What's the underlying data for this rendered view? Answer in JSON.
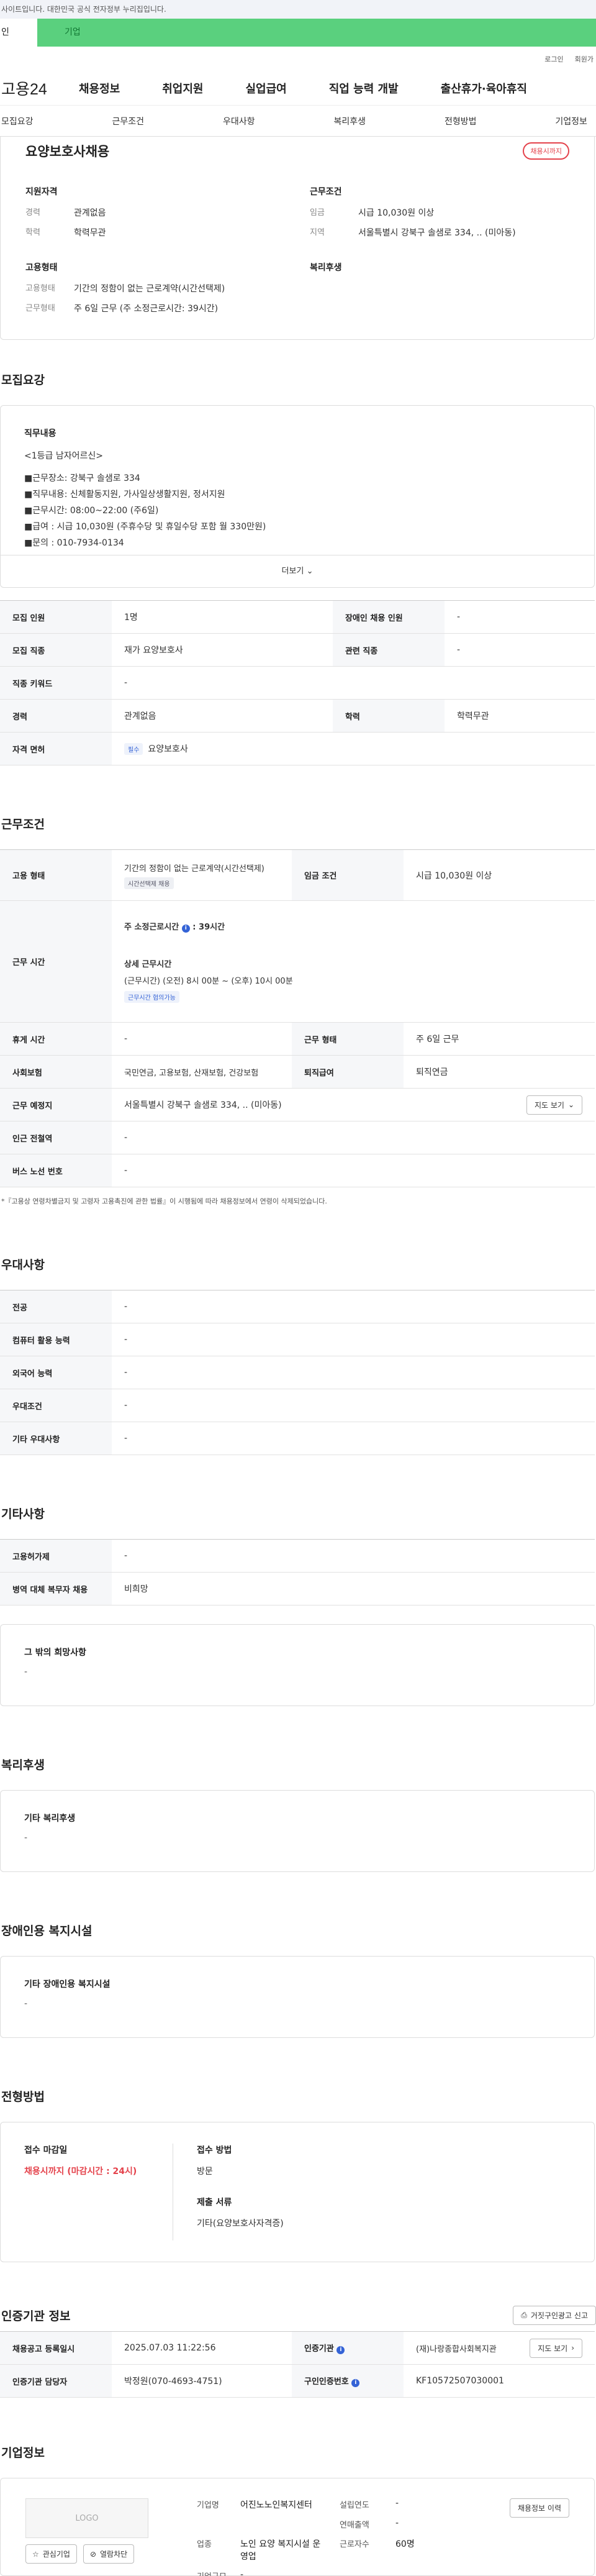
{
  "topbar": {
    "notice": "사이트입니다. 대한민국 공식 전자정부 누리집입니다."
  },
  "user_tabs": {
    "individual": "인",
    "company": "기업"
  },
  "login_links": [
    "로그인",
    "회원가"
  ],
  "gnb": {
    "logo": "고용24",
    "items": [
      "채용정보",
      "취업지원",
      "실업급여",
      "직업 능력 개발",
      "출산휴가·육아휴직"
    ]
  },
  "subnav": [
    "모집요강",
    "근무조건",
    "우대사항",
    "복리후생",
    "전형방법",
    "기업정보"
  ],
  "summary": {
    "title": "요양보호사채용",
    "badge": "채용시까지",
    "qualification": {
      "heading": "지원자격",
      "rows": [
        {
          "k": "경력",
          "v": "관계없음"
        },
        {
          "k": "학력",
          "v": "학력무관"
        }
      ]
    },
    "employment": {
      "heading": "고용형태",
      "rows": [
        {
          "k": "고용형태",
          "v": "기간의 정함이 없는 근로계약(시간선택제)"
        },
        {
          "k": "근무형태",
          "v": "주 6일 근무 (주 소정근로시간: 39시간)"
        }
      ]
    },
    "conditions": {
      "heading": "근무조건",
      "rows": [
        {
          "k": "임금",
          "v": "시급 10,030원 이상"
        },
        {
          "k": "지역",
          "v": "서울특별시 강북구 솔샘로 334, .. (미아동)"
        }
      ]
    },
    "welfare": {
      "heading": "복리후생"
    }
  },
  "recruit": {
    "title": "모집요강",
    "duty_heading": "직무내용",
    "duty_lines": [
      "<1등급 남자어르신>",
      "■근무장소: 강북구 솔샘로 334",
      "■직무내용: 신체활동지원, 가사일상생활지원, 정서지원",
      "■근무시간: 08:00~22:00 (주6일)",
      "■급여 : 시급 10,030원 (주휴수당 및 휴일수당 포함 월 330만원)",
      "■문의 : 010-7934-0134"
    ],
    "more": "더보기",
    "table": [
      [
        "모집 인원",
        "1명",
        "장애인 채용 인원",
        "-"
      ],
      [
        "모집 직종",
        "재가 요양보호사",
        "관련 직종",
        "-"
      ],
      [
        "직종 키워드",
        "-",
        "",
        ""
      ],
      [
        "경력",
        "관계없음",
        "학력",
        "학력무관"
      ]
    ],
    "license_label": "자격 면허",
    "license_tag": "필수",
    "license_value": "요양보호사"
  },
  "work": {
    "title": "근무조건",
    "employ_type_label": "고용 형태",
    "employ_type_value": "기간의 정함이 없는 근로계약(시간선택제)",
    "employ_type_tag": "시간선택제 채용",
    "wage_label": "임금 조건",
    "wage_value": "시급 10,030원 이상",
    "hours_label": "근무 시간",
    "hours_weekly": "주 소정근로시간",
    "hours_weekly_value": "39시간",
    "hours_detail_heading": "상세 근무시간",
    "hours_detail": "(근무시간) (오전) 8시 00분 ~ (오후) 10시 00분",
    "hours_tag": "근무시간 협의가능",
    "rest_label": "휴게 시간",
    "rest_value": "-",
    "form_label": "근무 형태",
    "form_value": "주 6일 근무",
    "insurance_label": "사회보험",
    "insurance_value": "국민연금, 고용보험, 산재보험, 건강보험",
    "retire_label": "퇴직급여",
    "retire_value": "퇴직연금",
    "place_label": "근무 예정지",
    "place_value": "서울특별시 강북구 솔샘로 334, .. (미아동)",
    "map_btn": "지도 보기",
    "subway_label": "인근 전철역",
    "subway_value": "-",
    "bus_label": "버스 노선 번호",
    "bus_value": "-",
    "note": "*『고용상 연령차별금지 및 고령자 고용촉진에 관한 법률』이 시행됨에 따라 채용정보에서 연령이 삭제되었습니다."
  },
  "prefer": {
    "title": "우대사항",
    "rows": [
      [
        "전공",
        "-"
      ],
      [
        "컴퓨터 활용 능력",
        "-"
      ],
      [
        "외국어 능력",
        "-"
      ],
      [
        "우대조건",
        "-"
      ],
      [
        "기타 우대사항",
        "-"
      ]
    ]
  },
  "etc": {
    "title": "기타사항",
    "rows": [
      [
        "고용허가제",
        "-"
      ],
      [
        "병역 대체 복무자 채용",
        "비희망"
      ]
    ],
    "wish_heading": "그 밖의 희망사항",
    "wish_value": "-"
  },
  "welfare_sec": {
    "title": "복리후생",
    "heading": "기타 복리후생",
    "value": "-"
  },
  "disabled_sec": {
    "title": "장애인용 복지시설",
    "heading": "기타 장애인용 복지시설",
    "value": "-"
  },
  "method": {
    "title": "전형방법",
    "deadline_heading": "접수 마감일",
    "deadline_value": "채용시까지 (마감시간 : 24시)",
    "way_heading": "접수 방법",
    "way_value": "방문",
    "docs_heading": "제출 서류",
    "docs_value": "기타(요양보호사자격증)"
  },
  "cert": {
    "title": "인증기관 정보",
    "report_btn": "거짓구인광고 신고",
    "reg_label": "채용공고 등록일시",
    "reg_value": "2025.07.03 11:22:56",
    "org_label": "인증기관",
    "org_value": "(재)나랑종합사회복지관",
    "map_btn": "지도 보기",
    "staff_label": "인증기관 담당자",
    "staff_value": "박정원(070-4693-4751)",
    "num_label": "구인인증번호",
    "num_value": "KF10572507030001"
  },
  "company": {
    "title": "기업정보",
    "logo_text": "LOGO",
    "fav_btn": "관심기업",
    "block_btn": "열람차단",
    "history_btn": "채용정보 이력",
    "name_label": "기업명",
    "name_value": "어진노노인복지센터",
    "est_label": "설립연도",
    "est_value": "-",
    "sales_label": "연매출액",
    "sales_value": "-",
    "industry_label": "업종",
    "industry_value": "노인 요양 복지시설 운영업",
    "workers_label": "근로자수",
    "workers_value": "60명",
    "size_label": "기업규모",
    "size_value": "-"
  },
  "colors": {
    "accent_green": "#5ad07e",
    "accent_red": "#e4424b",
    "accent_blue": "#3463d6"
  }
}
